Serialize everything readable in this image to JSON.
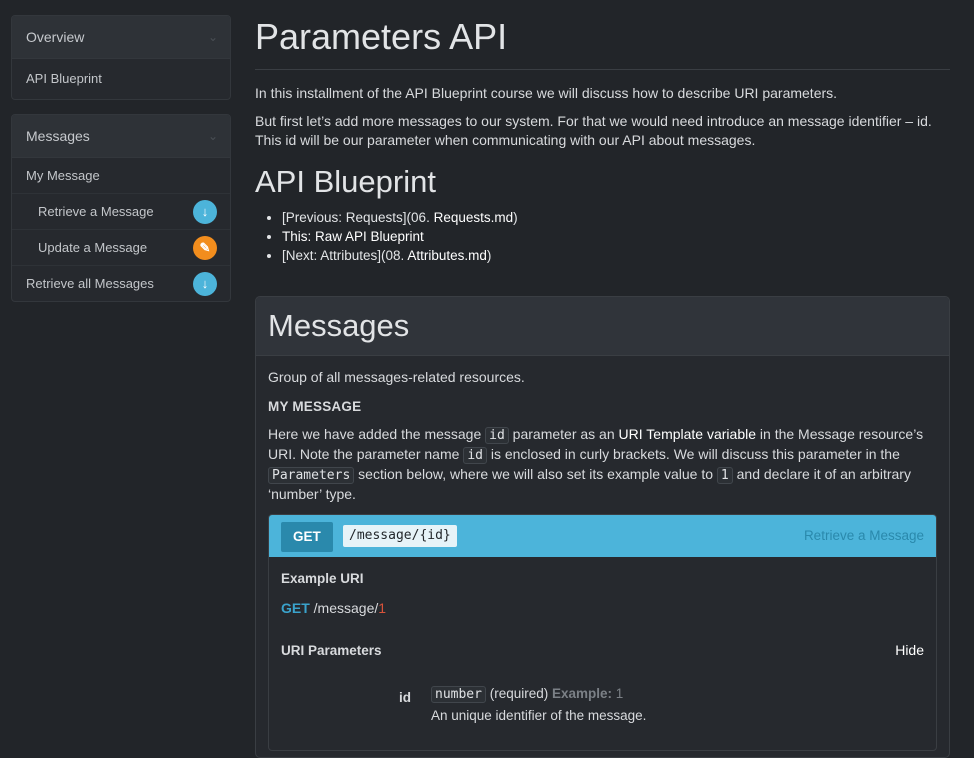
{
  "sidebar": {
    "groups": [
      {
        "heading": "Overview",
        "items": [
          {
            "label": "API Blueprint"
          }
        ]
      },
      {
        "heading": "Messages",
        "items": [
          {
            "label": "My Message"
          },
          {
            "label": "Retrieve a Message",
            "badge": "down-arrow-icon",
            "badge_color": "#4cb4da"
          },
          {
            "label": "Update a Message",
            "badge": "pencil-icon",
            "badge_color": "#f28d1d"
          },
          {
            "label": "Retrieve all Messages",
            "badge": "down-arrow-icon",
            "badge_color": "#4cb4da"
          }
        ]
      }
    ]
  },
  "main": {
    "title": "Parameters API",
    "intro": "In this installment of the API Blueprint course we will discuss how to describe URI parameters.",
    "para2": "But first let’s add more messages to our system. For that we would need introduce an message identifier – id. This id will be our parameter when communicating with our API about messages.",
    "subtitle": "API Blueprint",
    "links": [
      {
        "prefix": "[Previous: Requests](06. ",
        "bold": "Requests.md",
        "suffix": ")"
      },
      {
        "prefix": "This: Raw API Blueprint",
        "bold": "",
        "suffix": ""
      },
      {
        "prefix": "[Next: Attributes](08. ",
        "bold": "Attributes.md",
        "suffix": ")"
      }
    ]
  },
  "group": {
    "title": "Messages",
    "description": "Group of all messages-related resources.",
    "resource": {
      "name": "MY MESSAGE",
      "desc": {
        "t1": "Here we have added the message ",
        "c1": "id",
        "t2": " parameter as an ",
        "b1": "URI Template variable",
        "t3": " in the Message resource’s URI. Note the parameter name ",
        "c2": "id",
        "t4": " is enclosed in curly brackets. We will discuss this parameter in the ",
        "c3": "Parameters",
        "t5": " section below, where we will also set its example value to ",
        "c4": "1",
        "t6": " and declare it of an arbitrary ‘number’ type."
      }
    },
    "action": {
      "method": "GET",
      "uri": "/message/{id}",
      "title": "Retrieve a Message",
      "example_label": "Example URI",
      "example_method": "GET",
      "example_path": " /message/",
      "example_value": "1",
      "params_label": "URI Parameters",
      "hide_label": "Hide",
      "param": {
        "name": "id",
        "type": "number",
        "required": " (required) ",
        "example_label": "Example:",
        "example_value": " 1",
        "description": "An unique identifier of the message."
      }
    }
  },
  "colors": {
    "accent": "#4cb4da",
    "method_bg": "#2a89ac",
    "edit": "#f28d1d"
  }
}
